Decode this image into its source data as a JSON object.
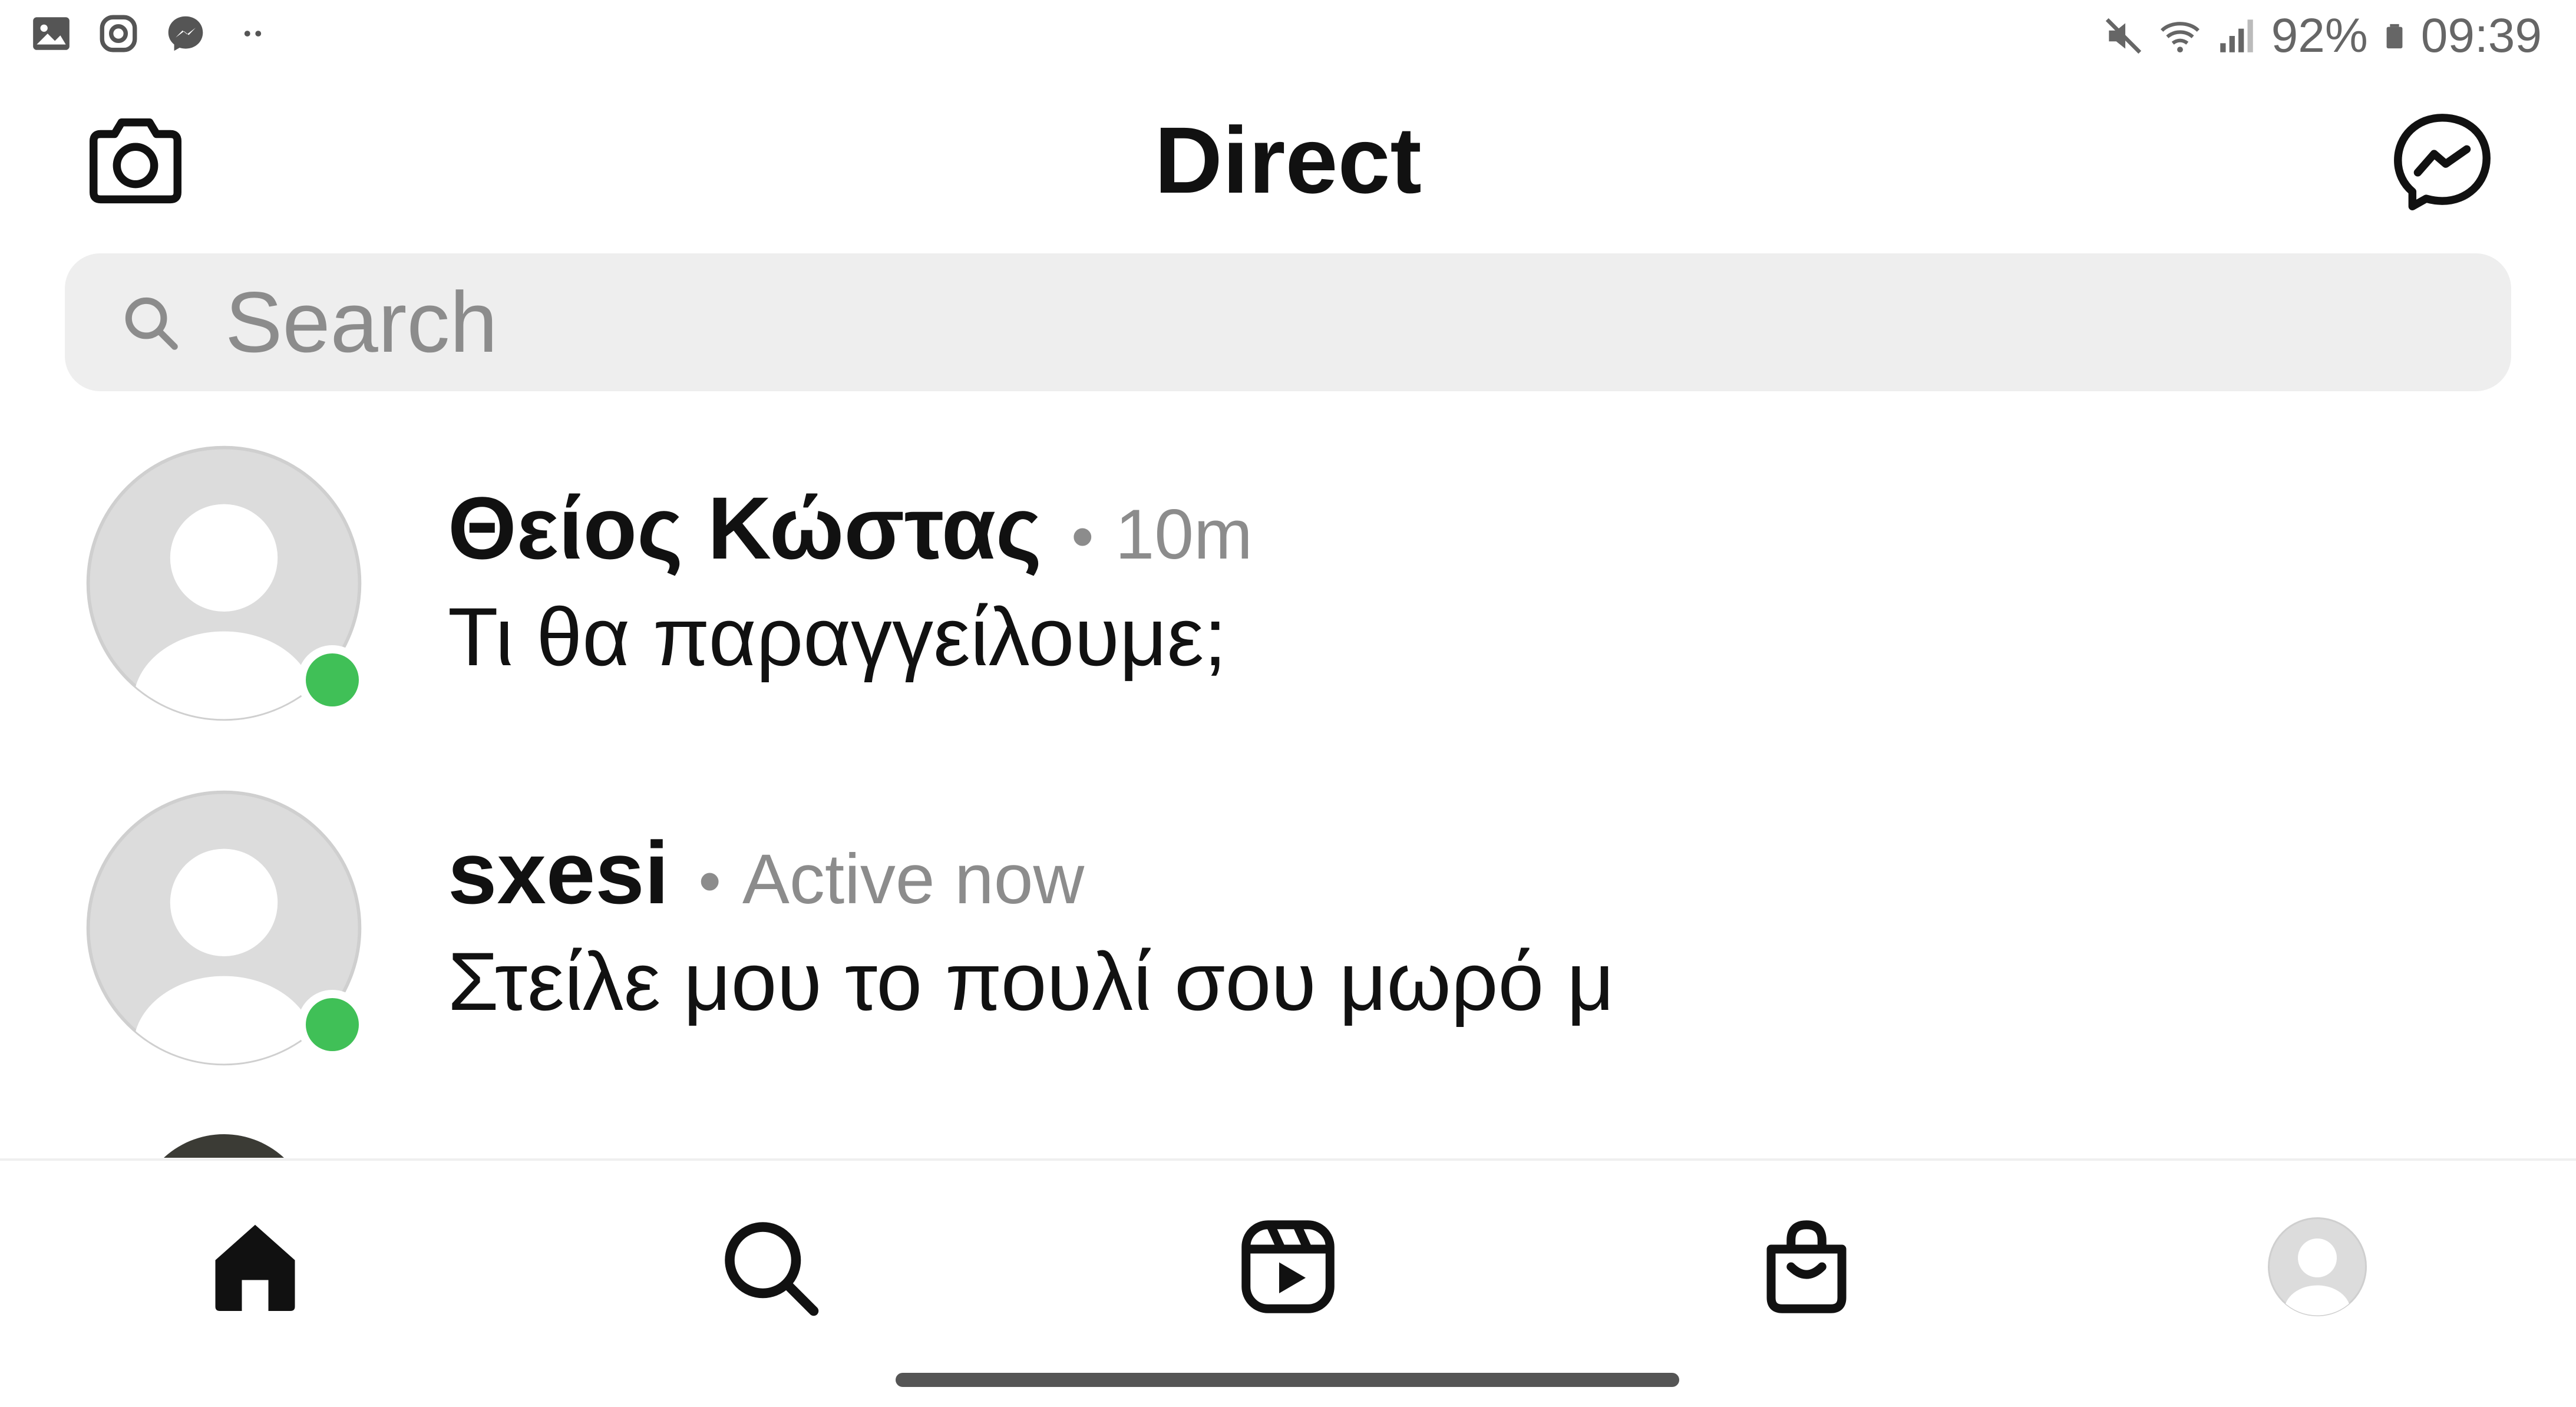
{
  "status_bar": {
    "left_icons": [
      "gallery-icon",
      "instagram-icon",
      "messenger-icon",
      "more-dots-icon"
    ],
    "right_icons": [
      "mute-icon",
      "wifi-icon",
      "signal-icon",
      "battery-icon"
    ],
    "battery": "92%",
    "time": "09:39"
  },
  "header": {
    "title": "Direct",
    "left_icon": "camera-icon",
    "right_icon": "messenger-icon"
  },
  "search": {
    "placeholder": "Search",
    "value": ""
  },
  "conversations": [
    {
      "name": "Θείος Κώστας",
      "separator": "•",
      "meta": "10m",
      "message": "Τι θα παραγγείλουμε;",
      "online": true
    },
    {
      "name": "sxesi",
      "separator": "•",
      "meta": "Active now",
      "message": "Στείλε μου το πουλί σου μωρό μ",
      "online": true
    }
  ],
  "tab_bar": {
    "tabs": [
      "home-icon",
      "search-icon",
      "reels-icon",
      "shop-icon",
      "profile-avatar"
    ],
    "active": "home-icon"
  },
  "colors": {
    "online": "#40c057",
    "search_bg": "#eeeeee",
    "meta_text": "#8c8c8c",
    "primary_text": "#111111"
  }
}
